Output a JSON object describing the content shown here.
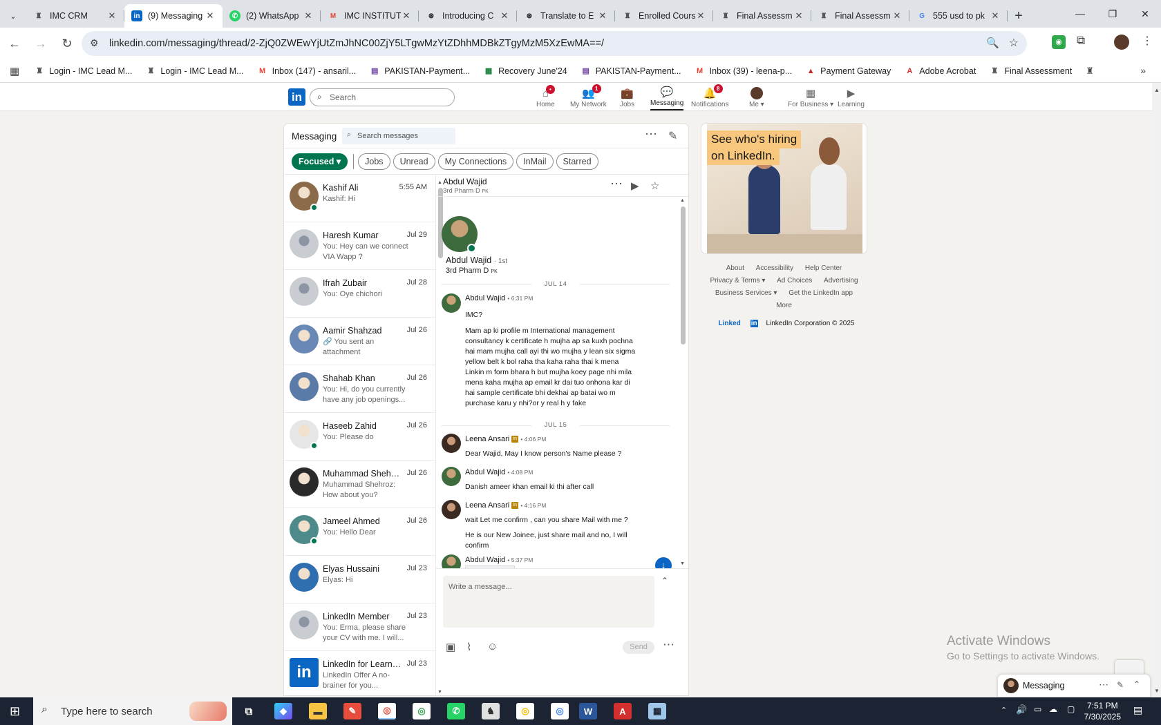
{
  "browser": {
    "tabs": [
      {
        "title": "IMC CRM",
        "favicon": "imc-icon",
        "color": "#555555"
      },
      {
        "title": "(9) Messaging",
        "favicon": "linkedin-icon",
        "color": "#0a66c2",
        "active": true
      },
      {
        "title": "(2) WhatsApp",
        "favicon": "whatsapp-icon",
        "color": "#25d366"
      },
      {
        "title": "IMC INSTITUTE",
        "favicon": "gmail-icon",
        "color": "#ea4335"
      },
      {
        "title": "Introducing C",
        "favicon": "openai-icon",
        "color": "#222222"
      },
      {
        "title": "Translate to E",
        "favicon": "openai-icon",
        "color": "#222222"
      },
      {
        "title": "Enrolled Cours",
        "favicon": "imc-icon",
        "color": "#555555"
      },
      {
        "title": "Final Assessm",
        "favicon": "imc-icon",
        "color": "#555555"
      },
      {
        "title": "Final Assessm",
        "favicon": "imc-icon",
        "color": "#555555"
      },
      {
        "title": "555 usd to pk",
        "favicon": "google-icon",
        "color": "#4285f4"
      }
    ],
    "new_tab": "+",
    "url": "linkedin.com/messaging/thread/2-ZjQ0ZWEwYjUtZmJhNC00ZjY5LTgwMzYtZDhhMDBkZTgyMzM5XzEwMA==/",
    "bookmarks": [
      {
        "label": "Login - IMC Lead M...",
        "icon": "imc-icon"
      },
      {
        "label": "Login - IMC Lead M...",
        "icon": "imc-icon"
      },
      {
        "label": "Inbox (147) - ansaril...",
        "icon": "gmail-icon"
      },
      {
        "label": "PAKISTAN-Payment...",
        "icon": "form-icon"
      },
      {
        "label": "Recovery June'24",
        "icon": "sheets-icon"
      },
      {
        "label": "PAKISTAN-Payment...",
        "icon": "form-icon"
      },
      {
        "label": "Inbox (39) - leena-p...",
        "icon": "gmail-icon"
      },
      {
        "label": "Payment Gateway",
        "icon": "payment-icon"
      },
      {
        "label": "Adobe Acrobat",
        "icon": "acrobat-icon"
      },
      {
        "label": "Final Assessment",
        "icon": "imc-icon"
      }
    ]
  },
  "linkedin": {
    "search_placeholder": "Search",
    "nav": [
      {
        "label": "Home",
        "icon": "home-icon",
        "badge": "•"
      },
      {
        "label": "My Network",
        "icon": "network-icon",
        "badge": "1"
      },
      {
        "label": "Jobs",
        "icon": "jobs-icon",
        "badge": ""
      },
      {
        "label": "Messaging",
        "icon": "messaging-icon",
        "badge": "",
        "active": true
      },
      {
        "label": "Notifications",
        "icon": "bell-icon",
        "badge": "8"
      },
      {
        "label": "Me ▾",
        "icon": "avatar-icon",
        "badge": ""
      },
      {
        "label": "For Business ▾",
        "icon": "grid-icon",
        "badge": ""
      },
      {
        "label": "Learning",
        "icon": "learning-icon",
        "badge": ""
      }
    ]
  },
  "messaging": {
    "title": "Messaging",
    "search_placeholder": "Search messages",
    "filters": {
      "focused": "Focused ▾",
      "chips": [
        "Jobs",
        "Unread",
        "My Connections",
        "InMail",
        "Starred"
      ]
    },
    "conversations": [
      {
        "name": "Kashif Ali",
        "date": "5:55 AM",
        "preview": "Kashif: Hi",
        "online": true,
        "avatar": "#8b6b4a"
      },
      {
        "name": "Haresh Kumar",
        "date": "Jul 29",
        "preview": "You: Hey can we connect VIA Wapp ?",
        "online": false,
        "avatar": "#c9ccd1"
      },
      {
        "name": "Ifrah Zubair",
        "date": "Jul 28",
        "preview": "You: Oye chichori",
        "online": false,
        "avatar": "#c9ccd1"
      },
      {
        "name": "Aamir Shahzad",
        "date": "Jul 26",
        "preview": "🔗 You sent an attachment",
        "online": false,
        "avatar": "#6a88b5"
      },
      {
        "name": "Shahab Khan",
        "date": "Jul 26",
        "preview": "You: Hi, do you currently have any job openings...",
        "online": false,
        "avatar": "#5a7aa8"
      },
      {
        "name": "Haseeb Zahid",
        "date": "Jul 26",
        "preview": "You: Please do",
        "online": true,
        "avatar": "#e6e6e6"
      },
      {
        "name": "Muhammad Shehroz...",
        "date": "Jul 26",
        "preview": "Muhammad Shehroz: How about you?",
        "online": false,
        "avatar": "#2a2a2a"
      },
      {
        "name": "Jameel Ahmed",
        "date": "Jul 26",
        "preview": "You: Hello Dear",
        "online": true,
        "avatar": "#4f8a8b"
      },
      {
        "name": "Elyas Hussaini",
        "date": "Jul 23",
        "preview": "Elyas: Hi",
        "online": false,
        "avatar": "#2f6fb0"
      },
      {
        "name": "LinkedIn Member",
        "date": "Jul 23",
        "preview": "You: Erma, please share your CV with me. I will...",
        "online": false,
        "avatar": "#c9ccd1"
      },
      {
        "name": "LinkedIn for Learning",
        "date": "Jul 23",
        "preview": "LinkedIn Offer  A no-brainer for you...",
        "online": false,
        "avatar": "#0a66c2"
      }
    ],
    "thread": {
      "name": "Abdul Wajid",
      "headline": "3rd Pharm D",
      "headline_flag": "PK",
      "profile_name": "Abdul Wajid",
      "degree": "· 1st",
      "profile_headline": "3rd Pharm D",
      "day1": "JUL 14",
      "day2": "JUL 15",
      "messages": [
        {
          "sender": "Abdul Wajid",
          "time": "• 6:31 PM",
          "text": "IMC?"
        },
        {
          "text": "Mam ap ki profile m International management consultancy k certificate h mujha ap sa kuxh pochna hai mam mujha call ayi thi wo mujha y lean six sigma yellow belt k bol raha tha kaha raha thai k mena Linkin m form bhara h but mujha koey page nhi mila mena kaha mujha ap email kr dai tuo onhona kar di hai sample certificate bhi dekhai ap batai wo m purchase karu y nhi?or y real h y fake"
        },
        {
          "sender": "Leena Ansari",
          "time": "• 4:06 PM",
          "text": "Dear Wajid, May I know person's Name please ?"
        },
        {
          "sender": "Abdul Wajid",
          "time": "• 4:08 PM",
          "text": "Danish ameer khan email ki thi after call"
        },
        {
          "sender": "Leena Ansari",
          "time": "• 4:16 PM",
          "text": "wait Let me confirm , can you share Mail with me ?"
        },
        {
          "text": "He is our New Joinee, just share mail and no, I will confirm"
        },
        {
          "sender": "Abdul Wajid",
          "time": "• 5:37 PM",
          "text": ""
        }
      ],
      "compose_placeholder": "Write a message...",
      "send_label": "Send"
    }
  },
  "ad": {
    "line1": "See who's hiring",
    "line2": "on LinkedIn."
  },
  "footer": {
    "links": [
      "About",
      "Accessibility",
      "Help Center",
      "Privacy & Terms ▾",
      "Ad Choices",
      "Advertising",
      "Business Services ▾",
      "Get the LinkedIn app",
      "More"
    ],
    "brand": "Linked",
    "brand_in": "in",
    "copyright": "LinkedIn Corporation © 2025"
  },
  "mini_messaging": {
    "label": "Messaging"
  },
  "watermark": {
    "line1": "Activate Windows",
    "line2": "Go to Settings to activate Windows."
  },
  "taskbar": {
    "search_placeholder": "Type here to search",
    "time": "7:51 PM",
    "date": "7/30/2025"
  }
}
